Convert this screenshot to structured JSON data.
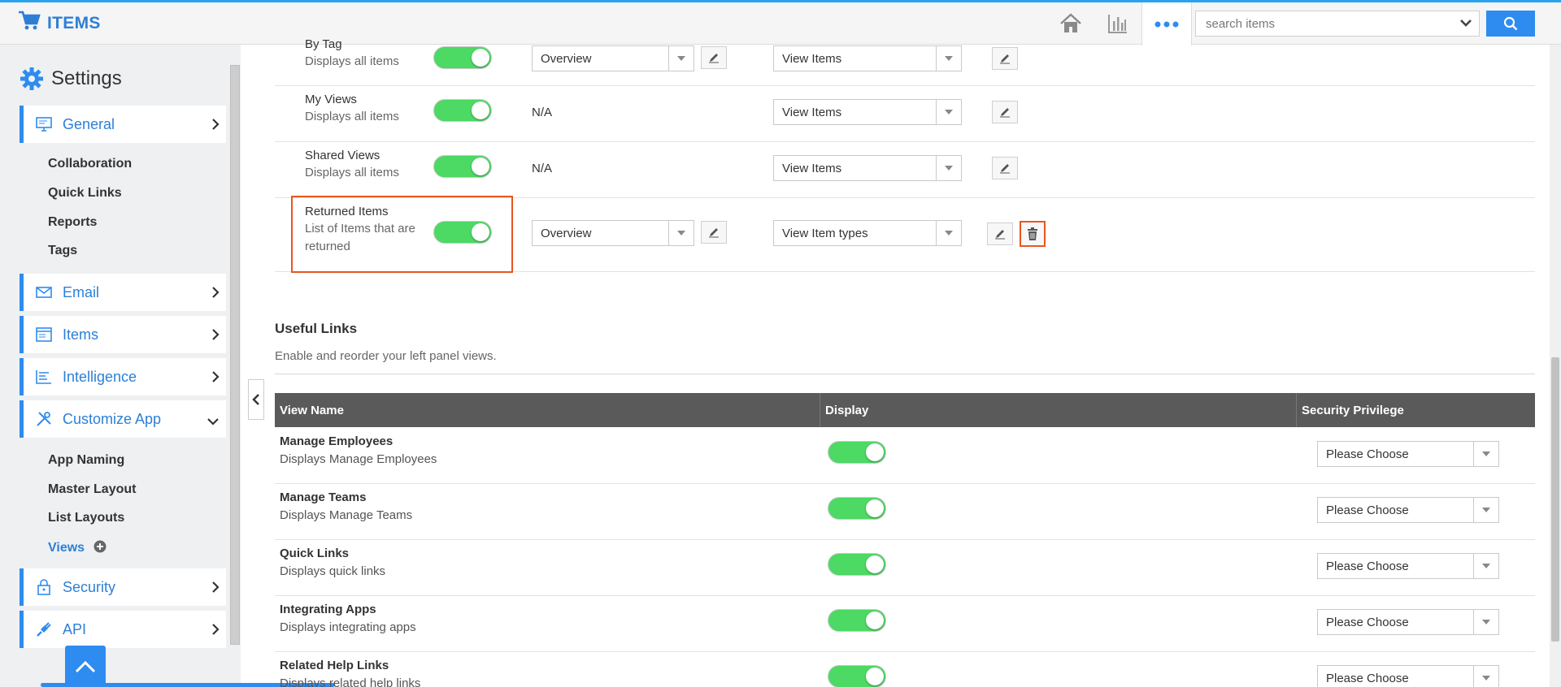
{
  "app": {
    "title": "ITEMS"
  },
  "search": {
    "placeholder": "search items"
  },
  "sidebar": {
    "title": "Settings",
    "items": [
      {
        "label": "General"
      },
      {
        "label": "Email"
      },
      {
        "label": "Items"
      },
      {
        "label": "Intelligence"
      },
      {
        "label": "Customize App"
      },
      {
        "label": "Security"
      },
      {
        "label": "API"
      }
    ],
    "general_sub": [
      "Collaboration",
      "Quick Links",
      "Reports",
      "Tags"
    ],
    "customize_sub": [
      "App Naming",
      "Master Layout",
      "List Layouts",
      "Views"
    ]
  },
  "views_rows": [
    {
      "title": "By Tag",
      "desc": "Displays all items",
      "layout": "Overview",
      "privilege": "View Items"
    },
    {
      "title": "My Views",
      "desc": "Displays all items",
      "layout": "N/A",
      "privilege": "View Items"
    },
    {
      "title": "Shared Views",
      "desc": "Displays all items",
      "layout": "N/A",
      "privilege": "View Items"
    },
    {
      "title": "Returned Items",
      "desc": "List of Items that are returned",
      "layout": "Overview",
      "privilege": "View Item types"
    }
  ],
  "useful_links": {
    "title": "Useful Links",
    "desc": "Enable and reorder your left panel views.",
    "columns": [
      "View Name",
      "Display",
      "Security Privilege"
    ],
    "rows": [
      {
        "title": "Manage Employees",
        "desc": "Displays Manage Employees",
        "privilege": "Please Choose"
      },
      {
        "title": "Manage Teams",
        "desc": "Displays Manage Teams",
        "privilege": "Please Choose"
      },
      {
        "title": "Quick Links",
        "desc": "Displays quick links",
        "privilege": "Please Choose"
      },
      {
        "title": "Integrating Apps",
        "desc": "Displays integrating apps",
        "privilege": "Please Choose"
      },
      {
        "title": "Related Help Links",
        "desc": "Displays related help links",
        "privilege": "Please Choose"
      }
    ]
  },
  "colors": {
    "accent": "#2e8cf0",
    "toggle_on": "#4cd964",
    "highlight": "#e8561f"
  }
}
